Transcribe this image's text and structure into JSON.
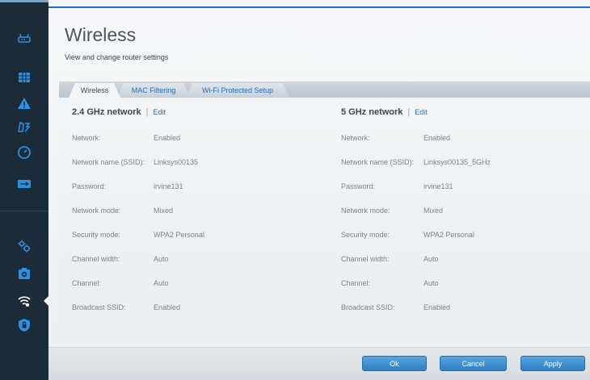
{
  "sidebar": {
    "items": [
      {
        "icon": "router-icon"
      },
      {
        "icon": "devices-grid-icon"
      },
      {
        "icon": "warning-icon"
      },
      {
        "icon": "parental-controls-icon"
      },
      {
        "icon": "speed-test-icon"
      },
      {
        "icon": "external-storage-icon"
      },
      {
        "icon": "settings-gears-icon"
      },
      {
        "icon": "troubleshooting-icon"
      },
      {
        "icon": "wireless-icon",
        "active": true
      },
      {
        "icon": "security-shield-icon"
      }
    ],
    "colors": {
      "background": "#1b2c38",
      "icon": "#2f8fe0"
    }
  },
  "header": {
    "title": "Wireless",
    "subtitle": "View and change router settings"
  },
  "tabs": [
    {
      "label": "Wireless",
      "active": true
    },
    {
      "label": "MAC Filtering",
      "active": false
    },
    {
      "label": "Wi-Fi Protected Setup",
      "active": false
    }
  ],
  "networks": [
    {
      "heading": "2.4 GHz network",
      "edit_label": "Edit",
      "rows": [
        {
          "label": "Network:",
          "value": "Enabled"
        },
        {
          "label": "Network name (SSID):",
          "value": "Linksys00135"
        },
        {
          "label": "Password:",
          "value": "irvine131"
        },
        {
          "label": "Network mode:",
          "value": "Mixed"
        },
        {
          "label": "Security mode:",
          "value": "WPA2 Personal"
        },
        {
          "label": "Channel width:",
          "value": "Auto"
        },
        {
          "label": "Channel:",
          "value": "Auto"
        },
        {
          "label": "Broadcast SSID:",
          "value": "Enabled"
        }
      ]
    },
    {
      "heading": "5 GHz network",
      "edit_label": "Edit",
      "rows": [
        {
          "label": "Network:",
          "value": "Enabled"
        },
        {
          "label": "Network name (SSID):",
          "value": "Linksys00135_5GHz"
        },
        {
          "label": "Password:",
          "value": "irvine131"
        },
        {
          "label": "Network mode:",
          "value": "Mixed"
        },
        {
          "label": "Security mode:",
          "value": "WPA2 Personal"
        },
        {
          "label": "Channel width:",
          "value": "Auto"
        },
        {
          "label": "Channel:",
          "value": "Auto"
        },
        {
          "label": "Broadcast SSID:",
          "value": "Enabled"
        }
      ]
    }
  ],
  "footer": {
    "ok_label": "Ok",
    "cancel_label": "Cancel",
    "apply_label": "Apply"
  },
  "colors": {
    "accent": "#1f6fb7",
    "button": "#3b8fd4"
  }
}
